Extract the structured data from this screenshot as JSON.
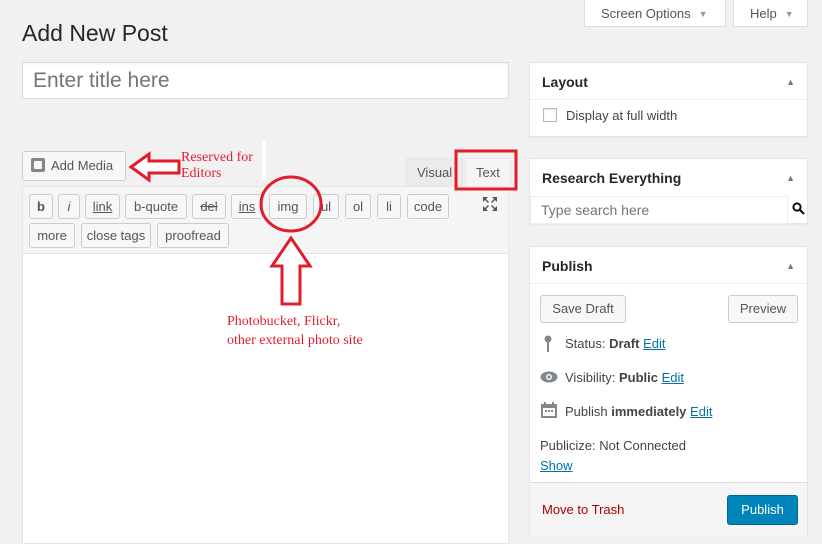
{
  "header": {
    "screen_options": "Screen Options",
    "help": "Help",
    "page_title": "Add New Post"
  },
  "editor": {
    "title_placeholder": "Enter title here",
    "add_media": "Add Media",
    "tabs": {
      "visual": "Visual",
      "text": "Text"
    },
    "quicktags": [
      "b",
      "i",
      "link",
      "b-quote",
      "del",
      "ins",
      "img",
      "ul",
      "ol",
      "li",
      "code",
      "more",
      "close tags",
      "proofread"
    ]
  },
  "sidebar": {
    "layout": {
      "title": "Layout",
      "checkbox_label": "Display at full width",
      "checked": false
    },
    "research": {
      "title": "Research Everything",
      "search_placeholder": "Type search here"
    },
    "publish": {
      "title": "Publish",
      "save_draft": "Save Draft",
      "preview": "Preview",
      "status_label": "Status:",
      "status_value": "Draft",
      "status_edit": "Edit",
      "visibility_label": "Visibility:",
      "visibility_value": "Public",
      "visibility_edit": "Edit",
      "publish_label": "Publish",
      "publish_value": "immediately",
      "publish_edit": "Edit",
      "publicize": "Publicize: Not Connected",
      "show": "Show",
      "trash": "Move to Trash",
      "publish_button": "Publish"
    }
  },
  "annotations": {
    "reserved": [
      "Reserved for",
      "Editors"
    ],
    "photo": [
      "Photobucket, Flickr,",
      "other external photo site"
    ]
  },
  "colors": {
    "accent": "#0085ba",
    "annotation_red": "#e01e2b",
    "trash_red": "#a00"
  }
}
